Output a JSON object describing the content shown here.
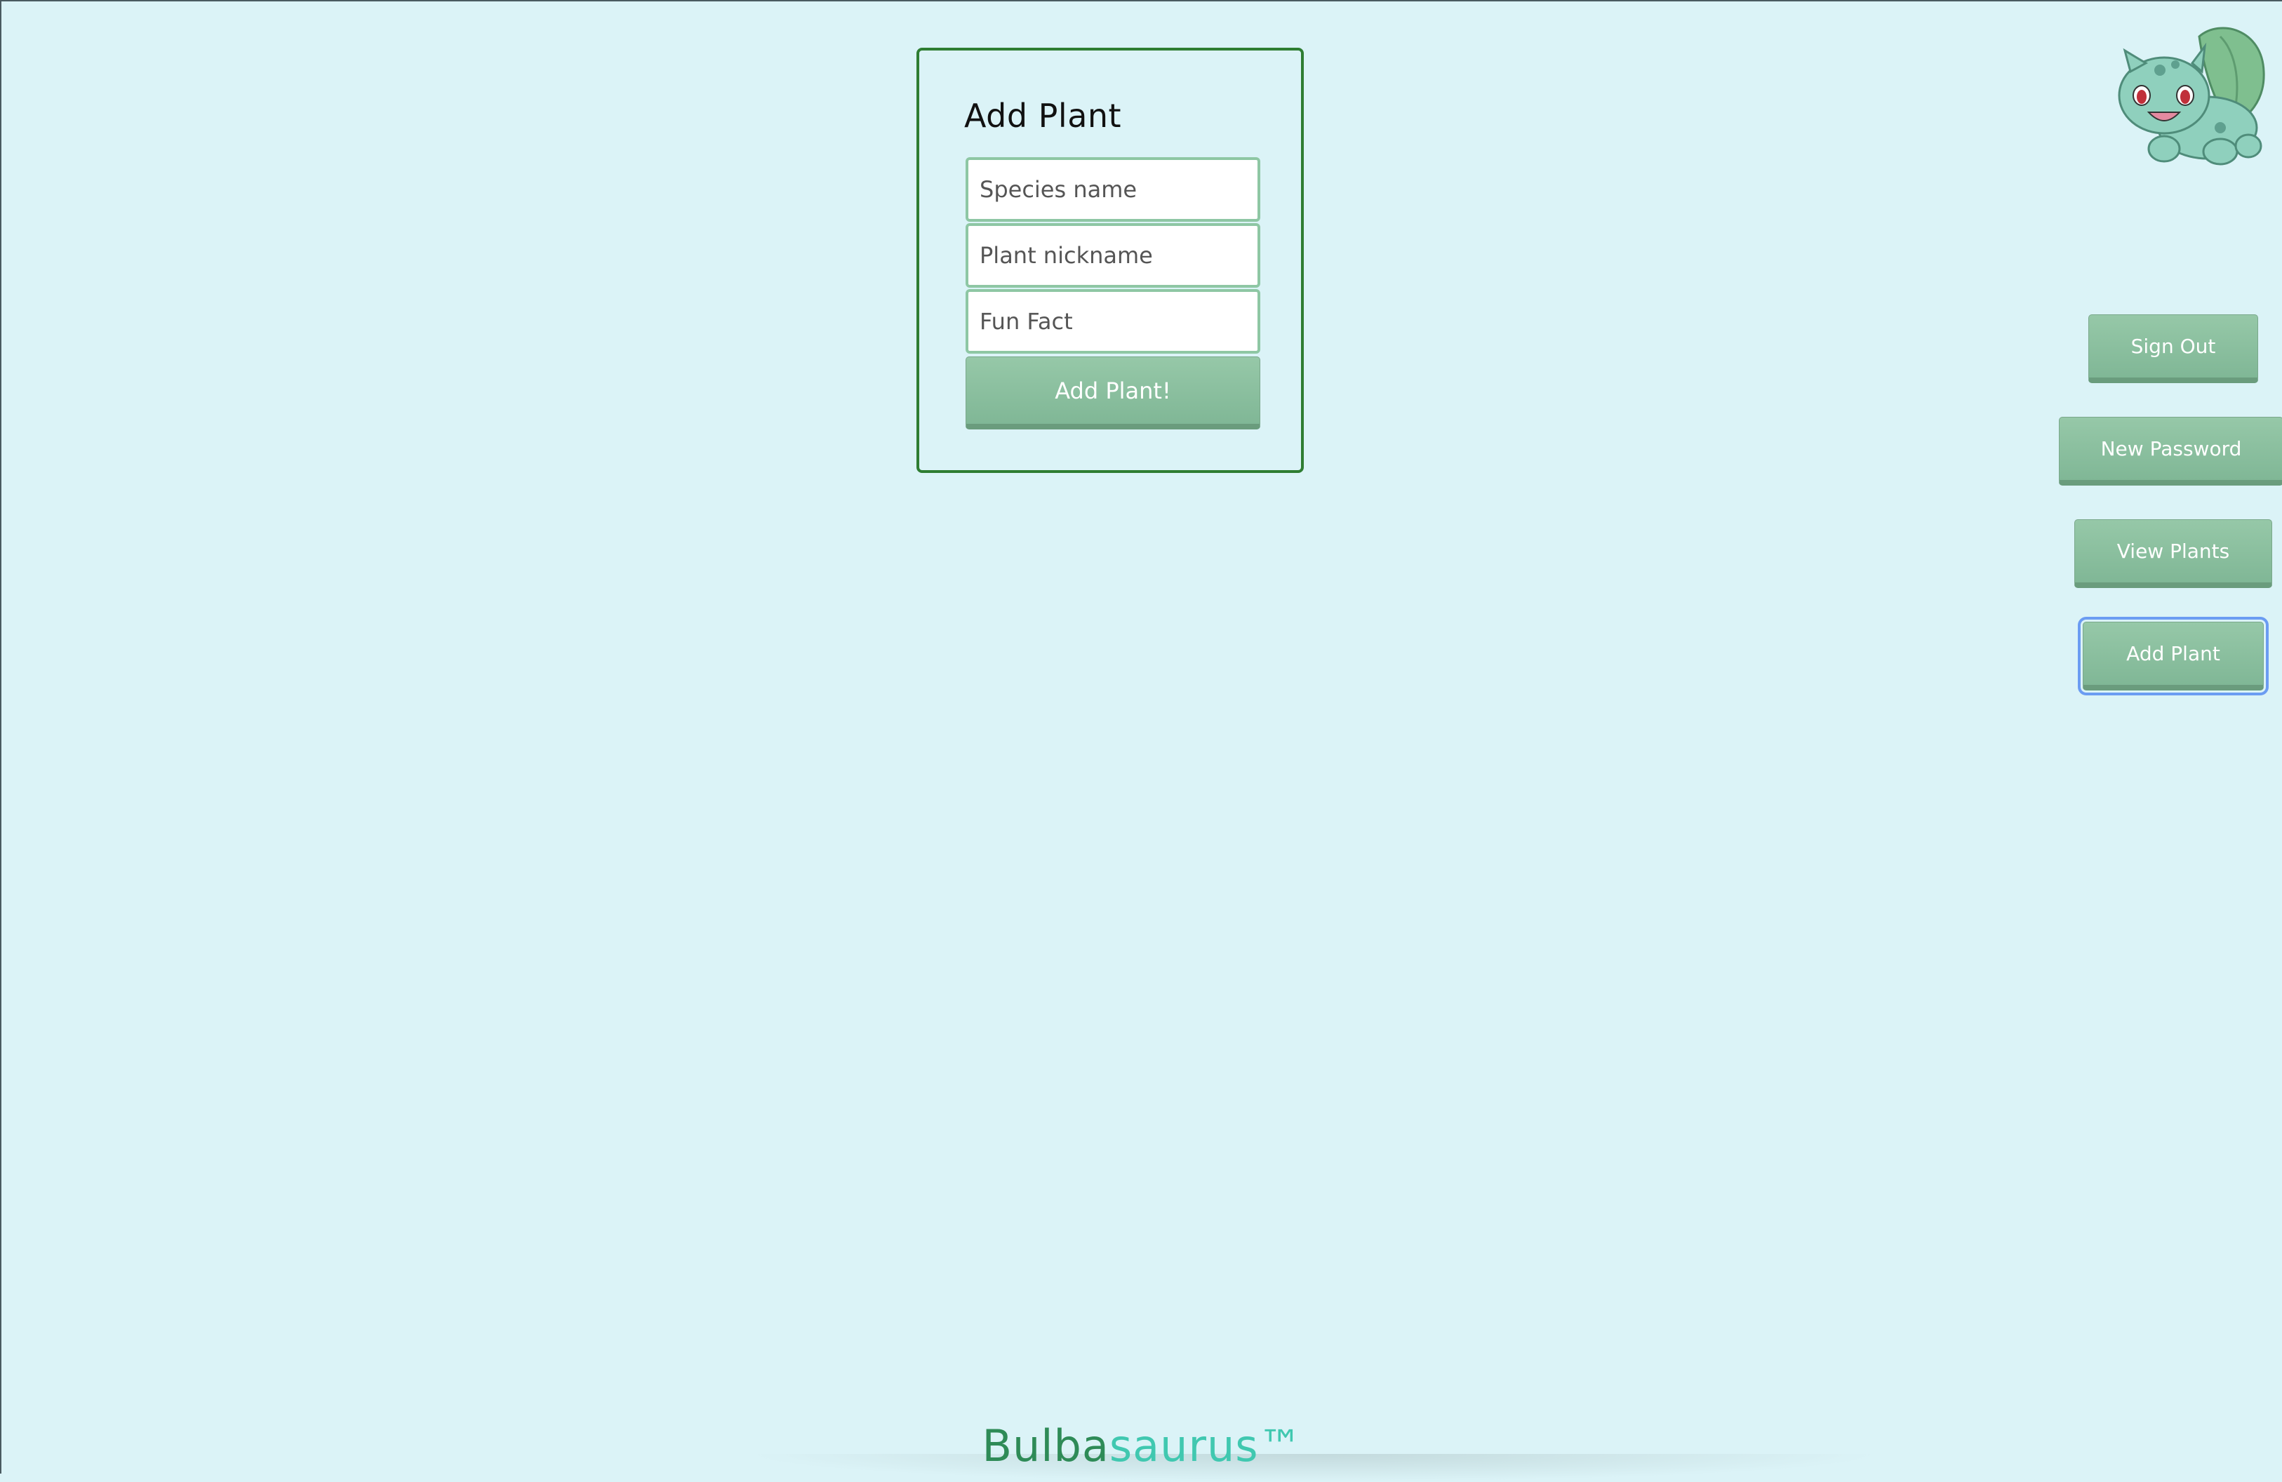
{
  "add_plant_form": {
    "title": "Add Plant",
    "species_placeholder": "Species name",
    "nickname_placeholder": "Plant nickname",
    "fun_fact_placeholder": "Fun Fact",
    "submit_label": "Add Plant!"
  },
  "nav": {
    "sign_out_label": "Sign Out",
    "new_password_label": "New Password",
    "view_plants_label": "View Plants",
    "add_plant_label": "Add Plant"
  },
  "mascot": {
    "icon": "bulbasaur-icon"
  },
  "footer": {
    "brand_part1": "Bulba",
    "brand_part2": "saurus™"
  },
  "colors": {
    "background": "#dbf3f7",
    "card_border": "#2e7d32",
    "button": "#8cc0a0",
    "brand_dark": "#2e8b57",
    "brand_light": "#40c8b0",
    "focus_ring": "#6b9cf2"
  }
}
